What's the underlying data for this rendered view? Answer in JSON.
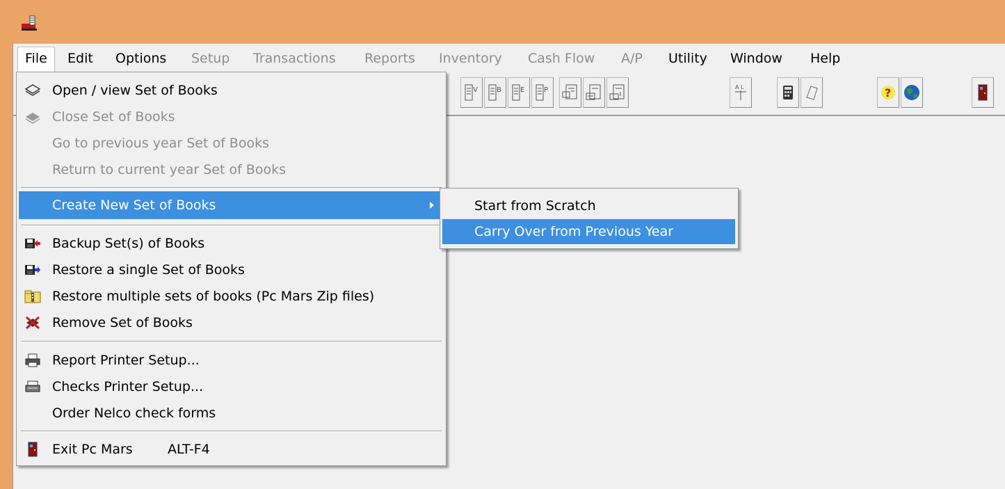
{
  "window": {
    "app_icon": "pc-mars-app-icon"
  },
  "menubar": {
    "items": [
      {
        "label": "File",
        "state": "active"
      },
      {
        "label": "Edit",
        "state": "enabled"
      },
      {
        "label": "Options",
        "state": "enabled"
      },
      {
        "label": "Setup",
        "state": "disabled"
      },
      {
        "label": "Transactions",
        "state": "disabled"
      },
      {
        "label": "Reports",
        "state": "disabled"
      },
      {
        "label": "Inventory",
        "state": "disabled"
      },
      {
        "label": "Cash Flow",
        "state": "disabled"
      },
      {
        "label": "A/P",
        "state": "disabled"
      },
      {
        "label": "Utility",
        "state": "enabled"
      },
      {
        "label": "Window",
        "state": "enabled"
      },
      {
        "label": "Help",
        "state": "enabled"
      }
    ]
  },
  "toolbar": {
    "buttons": [
      {
        "icon": "journal-v-icon"
      },
      {
        "icon": "journal-b-icon"
      },
      {
        "icon": "journal-e-icon"
      },
      {
        "icon": "journal-p-icon"
      },
      {
        "icon": "report-icon"
      },
      {
        "icon": "report-print-icon"
      },
      {
        "icon": "report-export-icon"
      },
      {
        "icon": "account-ledger-icon"
      },
      {
        "icon": "calculator-icon"
      },
      {
        "icon": "notepad-icon"
      },
      {
        "icon": "help-icon"
      },
      {
        "icon": "globe-icon"
      },
      {
        "icon": "exit-door-icon"
      }
    ]
  },
  "file_menu": {
    "open": "Open / view Set of Books",
    "close": "Close Set of Books",
    "prev_year": "Go to previous year Set of Books",
    "current_year": "Return to current year Set of Books",
    "create_new": "Create New Set of Books",
    "backup": "Backup Set(s) of Books",
    "restore_single": "Restore a single Set of Books",
    "restore_multiple": "Restore multiple sets of books (Pc Mars Zip files)",
    "remove": "Remove Set of Books",
    "report_printer": "Report Printer Setup...",
    "checks_printer": "Checks Printer Setup...",
    "order_checks": "Order Nelco check forms",
    "exit": "Exit Pc Mars",
    "exit_shortcut": "ALT-F4"
  },
  "submenu": {
    "scratch": "Start from Scratch",
    "carry_over": "Carry Over from Previous Year"
  },
  "colors": {
    "title_bar": "#e9a466",
    "highlight": "#3d8fe0",
    "disabled_text": "#8d8d8d"
  }
}
